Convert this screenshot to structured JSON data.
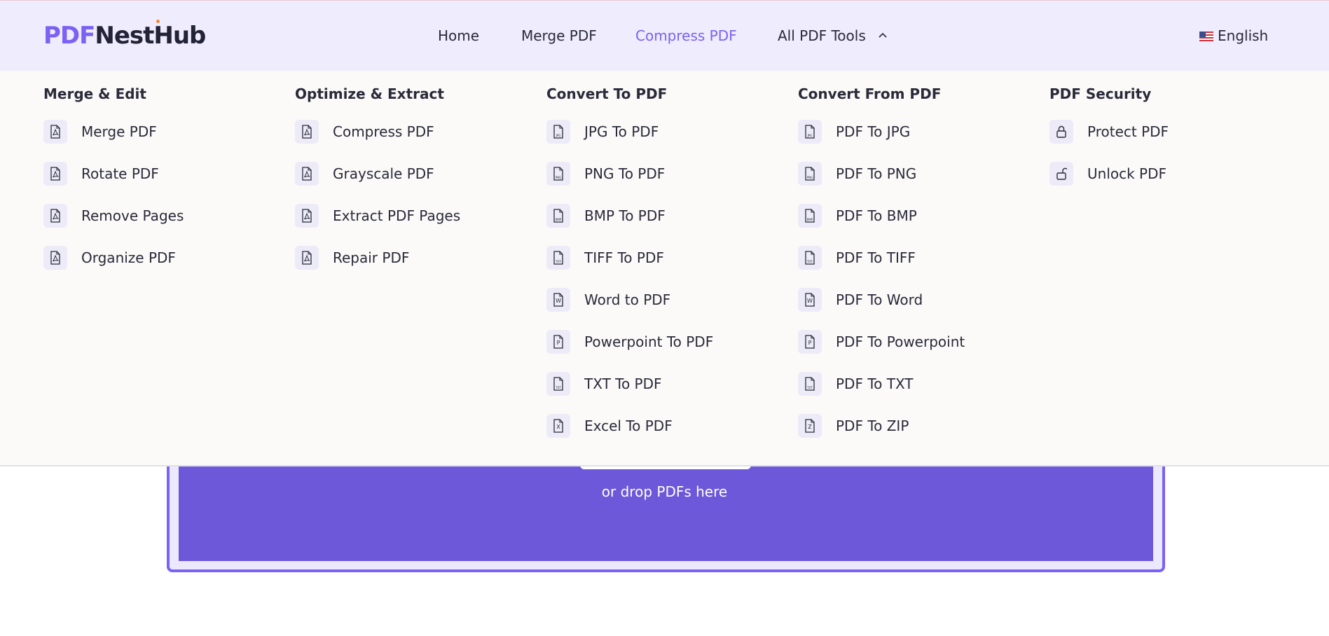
{
  "brand": {
    "logo_pdf": "PDF",
    "logo_nest": "Nest",
    "logo_hub": "Hub"
  },
  "nav": {
    "home": "Home",
    "merge": "Merge PDF",
    "compress": "Compress PDF",
    "all_tools": "All PDF Tools",
    "language": "English"
  },
  "menu": {
    "columns": [
      {
        "title": "Merge & Edit",
        "items": [
          {
            "label": "Merge PDF",
            "icon": "pdf-file-icon"
          },
          {
            "label": "Rotate PDF",
            "icon": "pdf-file-icon"
          },
          {
            "label": "Remove Pages",
            "icon": "pdf-file-icon"
          },
          {
            "label": "Organize PDF",
            "icon": "pdf-file-icon"
          }
        ]
      },
      {
        "title": "Optimize & Extract",
        "items": [
          {
            "label": "Compress PDF",
            "icon": "pdf-file-icon"
          },
          {
            "label": "Grayscale PDF",
            "icon": "pdf-file-icon"
          },
          {
            "label": "Extract PDF Pages",
            "icon": "pdf-file-icon"
          },
          {
            "label": "Repair PDF",
            "icon": "pdf-file-icon"
          }
        ]
      },
      {
        "title": "Convert To PDF",
        "items": [
          {
            "label": "JPG To PDF",
            "icon": "jpg-file-icon",
            "tag": "JPG"
          },
          {
            "label": "PNG To PDF",
            "icon": "png-file-icon",
            "tag": "PNG"
          },
          {
            "label": "BMP To PDF",
            "icon": "bmp-file-icon",
            "tag": "BMP"
          },
          {
            "label": "TIFF To PDF",
            "icon": "tiff-file-icon",
            "tag": "TIFF"
          },
          {
            "label": "Word to PDF",
            "icon": "word-file-icon",
            "tag": "W"
          },
          {
            "label": "Powerpoint To PDF",
            "icon": "powerpoint-file-icon",
            "tag": "P"
          },
          {
            "label": "TXT To PDF",
            "icon": "txt-file-icon",
            "tag": "TXT"
          },
          {
            "label": "Excel To PDF",
            "icon": "excel-file-icon",
            "tag": "X"
          }
        ]
      },
      {
        "title": "Convert From PDF",
        "items": [
          {
            "label": "PDF To JPG",
            "icon": "jpg-file-icon",
            "tag": "JPG"
          },
          {
            "label": "PDF To PNG",
            "icon": "png-file-icon",
            "tag": "PNG"
          },
          {
            "label": "PDF To BMP",
            "icon": "bmp-file-icon",
            "tag": "BMP"
          },
          {
            "label": "PDF To TIFF",
            "icon": "tiff-file-icon",
            "tag": "TIFF"
          },
          {
            "label": "PDF To Word",
            "icon": "word-file-icon",
            "tag": "W"
          },
          {
            "label": "PDF To Powerpoint",
            "icon": "powerpoint-file-icon",
            "tag": "P"
          },
          {
            "label": "PDF To TXT",
            "icon": "txt-file-icon",
            "tag": "TXT"
          },
          {
            "label": "PDF To ZIP",
            "icon": "zip-file-icon",
            "tag": "Z"
          }
        ]
      },
      {
        "title": "PDF Security",
        "items": [
          {
            "label": "Protect PDF",
            "icon": "lock-icon"
          },
          {
            "label": "Unlock PDF",
            "icon": "unlock-icon"
          }
        ]
      }
    ]
  },
  "upload": {
    "drop_text": "or drop PDFs here"
  },
  "colors": {
    "accent": "#7b61f4",
    "header_bg": "#efecfd",
    "upload_bg": "#6c58d8"
  }
}
